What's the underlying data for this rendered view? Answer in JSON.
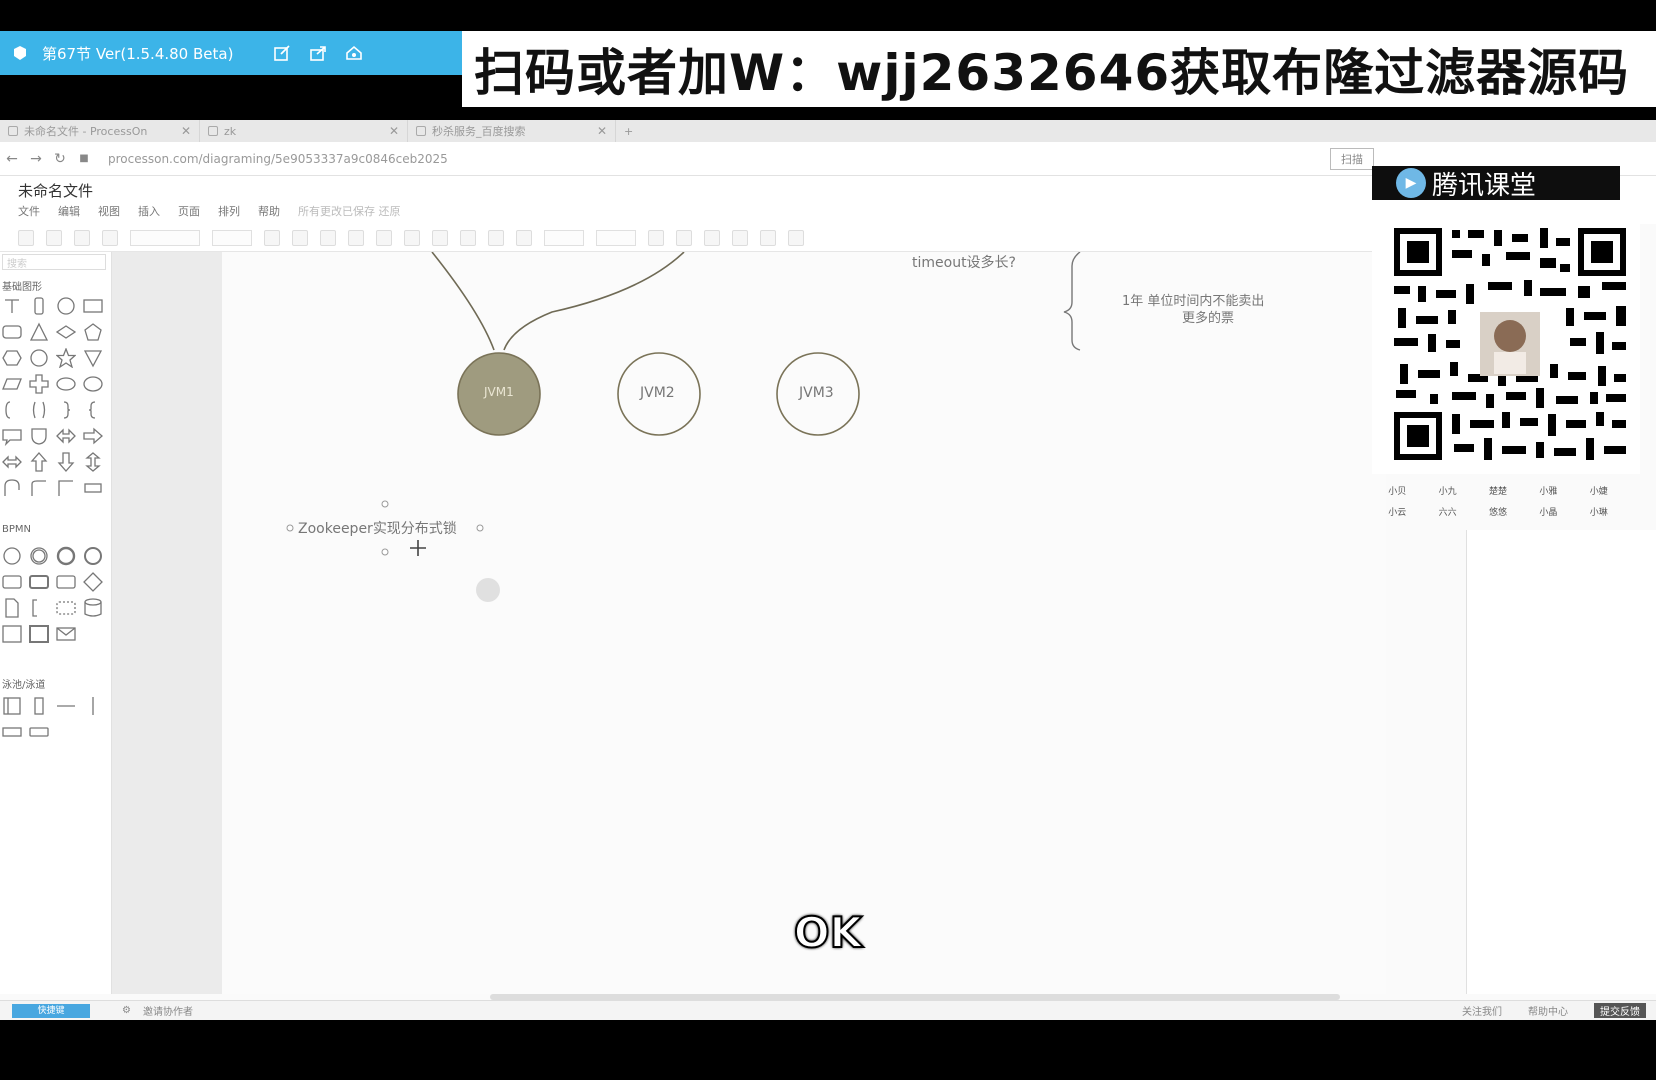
{
  "player": {
    "lesson_title": "第67节 Ver(1.5.4.80 Beta)"
  },
  "promo": {
    "text": "扫码或者加W：wjj2632646获取布隆过滤器源码"
  },
  "browser": {
    "tabs": [
      {
        "label": "未命名文件 - ProcessOn"
      },
      {
        "label": "zk"
      },
      {
        "label": "秒杀服务_百度搜索"
      }
    ],
    "url": "processon.com/diagraming/5e9053337a9c0846ceb2025",
    "scan_label": "扫描"
  },
  "document": {
    "title": "未命名文件",
    "menu": [
      "文件",
      "编辑",
      "视图",
      "插入",
      "页面",
      "排列",
      "帮助"
    ],
    "save_tip": "所有更改已保存 还原"
  },
  "shape_panel": {
    "search_placeholder": "搜索",
    "sections": [
      "基础图形",
      "BPMN",
      "泳池/泳道"
    ]
  },
  "diagram": {
    "node_jvm1": "JVM1",
    "node_jvm2": "JVM2",
    "node_jvm3": "JVM3",
    "timeout_question": "timeout设多长?",
    "note_line1": "1年 单位时间内不能卖出",
    "note_line2": "更多的票",
    "selected_text": "Zookeeper实现分布式锁"
  },
  "statusbar": {
    "shortcut": "快捷键",
    "invite": "邀请协作者",
    "follow": "关注我们",
    "help": "帮助中心",
    "feedback": "提交反馈"
  },
  "overlay": {
    "brand": "腾讯课堂",
    "names": [
      "小贝",
      "小九",
      "楚楚",
      "小雅",
      "小婕",
      "小云",
      "六六",
      "悠悠",
      "小晶",
      "小琳"
    ]
  },
  "subtitle": {
    "text": "OK"
  },
  "colors": {
    "player_bar": "#3cb4e8",
    "jvm1_fill": "#9f9b7f",
    "node_stroke": "#7a7358"
  }
}
